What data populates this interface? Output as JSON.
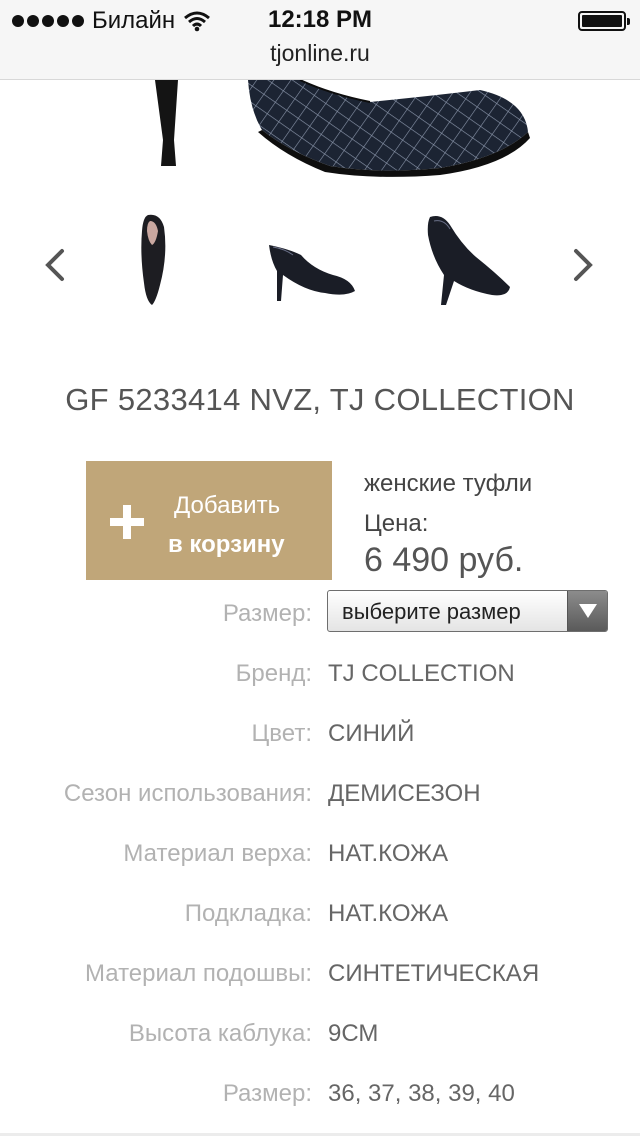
{
  "status_bar": {
    "carrier": "Билайн",
    "time": "12:18 PM",
    "url": "tjonline.ru",
    "icons": [
      "signal-dots-icon",
      "wifi-icon",
      "battery-icon"
    ]
  },
  "gallery": {
    "prev_icon": "chevron-left-icon",
    "next_icon": "chevron-right-icon",
    "thumbnail_count": 3
  },
  "product": {
    "title": "GF 5233414 NVZ, TJ COLLECTION",
    "category": "женские туфли",
    "price_label": "Цена:",
    "price": "6 490 руб."
  },
  "cart_button": {
    "line1": "Добавить",
    "line2": "в корзину",
    "icon": "plus-icon",
    "color": "#c0a679"
  },
  "size_select": {
    "label": "Размер:",
    "selected": "выберите размер",
    "icon": "triangle-down-icon"
  },
  "attributes": [
    {
      "label": "Бренд:",
      "value": "TJ COLLECTION"
    },
    {
      "label": "Цвет:",
      "value": "СИНИЙ"
    },
    {
      "label": "Сезон использования:",
      "value": "ДЕМИСЕЗОН"
    },
    {
      "label": "Материал верха:",
      "value": "НАТ.КОЖА"
    },
    {
      "label": "Подкладка:",
      "value": "НАТ.КОЖА"
    },
    {
      "label": "Материал подошвы:",
      "value": "СИНТЕТИЧЕСКАЯ"
    },
    {
      "label": "Высота каблука:",
      "value": "9СМ"
    },
    {
      "label": "Размер:",
      "value": "36, 37, 38, 39, 40"
    }
  ]
}
